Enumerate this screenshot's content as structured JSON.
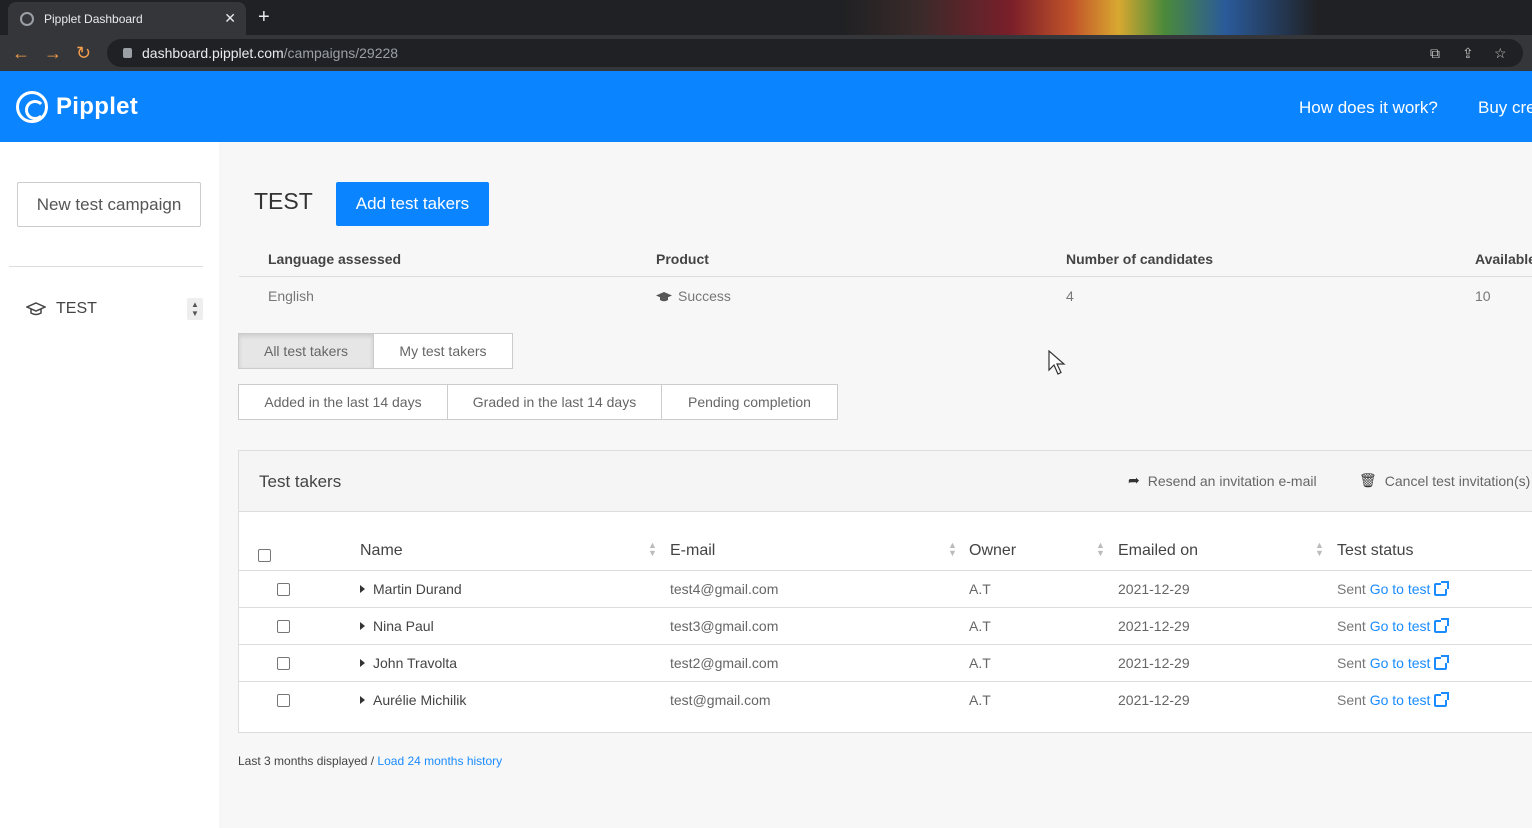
{
  "browser": {
    "tab_title": "Pipplet Dashboard",
    "tab_close": "✕",
    "new_tab": "+",
    "url_host": "dashboard.pipplet.com",
    "url_path": "/campaigns/29228"
  },
  "header": {
    "brand": "Pipplet",
    "links": [
      "How does it work?",
      "Buy cre"
    ]
  },
  "sidebar": {
    "new_campaign_label": "New test campaign",
    "items": [
      {
        "label": "TEST",
        "icon": "graduation-cap-icon"
      }
    ]
  },
  "campaign": {
    "title": "TEST",
    "add_button": "Add test takers",
    "info_headers": [
      "Language assessed",
      "Product",
      "Number of candidates",
      "Available"
    ],
    "info_values": [
      "English",
      "Success",
      "4",
      "10"
    ]
  },
  "filters": {
    "owner_tabs": [
      "All test takers",
      "My test takers"
    ],
    "time_tabs": [
      "Added in the last 14 days",
      "Graded in the last 14 days",
      "Pending completion"
    ]
  },
  "test_takers": {
    "title": "Test takers",
    "resend_label": "Resend an invitation e-mail",
    "cancel_label": "Cancel test invitation(s)",
    "columns": [
      "Name",
      "E-mail",
      "Owner",
      "Emailed on",
      "Test status"
    ],
    "rows": [
      {
        "name": "Martin Durand",
        "email": "test4@gmail.com",
        "owner": "A.T",
        "emailed": "2021-12-29",
        "status": "Sent",
        "link": "Go to test"
      },
      {
        "name": "Nina Paul",
        "email": "test3@gmail.com",
        "owner": "A.T",
        "emailed": "2021-12-29",
        "status": "Sent",
        "link": "Go to test"
      },
      {
        "name": "John Travolta",
        "email": "test2@gmail.com",
        "owner": "A.T",
        "emailed": "2021-12-29",
        "status": "Sent",
        "link": "Go to test"
      },
      {
        "name": "Aurélie Michilik",
        "email": "test@gmail.com",
        "owner": "A.T",
        "emailed": "2021-12-29",
        "status": "Sent",
        "link": "Go to test"
      }
    ]
  },
  "footer": {
    "note": "Last 3 months displayed / ",
    "load_link": "Load 24 months history"
  },
  "colors": {
    "brand_blue": "#0a84ff",
    "link_blue": "#1a8cff"
  }
}
